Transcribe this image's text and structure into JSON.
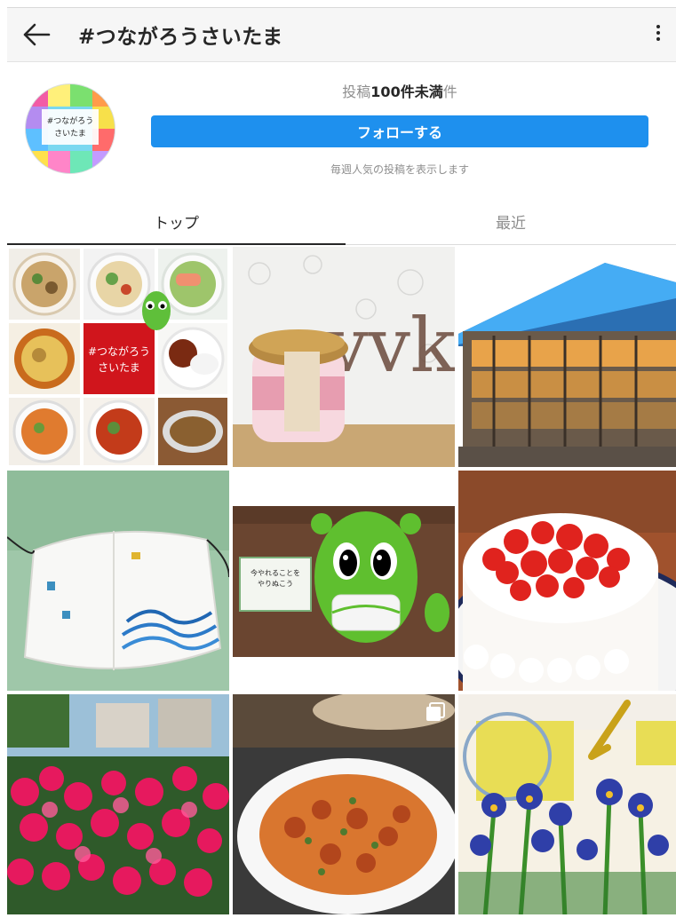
{
  "header": {
    "title": "#つながろうさいたま"
  },
  "profile": {
    "avatar_text": "#つながろう\nさいたま",
    "post_prefix": "投稿",
    "post_count": "100件未満",
    "post_suffix": "件",
    "follow_label": "フォローする",
    "weekly_note": "毎週人気の投稿を表示します"
  },
  "tabs": {
    "top": "トップ",
    "recent": "最近"
  },
  "posts": [
    {
      "id": "food-collage",
      "caption": "#つながろう\nさいたま"
    },
    {
      "id": "pudding-jar",
      "caption": "vvke"
    },
    {
      "id": "arena-building"
    },
    {
      "id": "wave-mask"
    },
    {
      "id": "mascot-with-mask",
      "sign_text": "今やれることを\nやりぬこう"
    },
    {
      "id": "strawberry-cake"
    },
    {
      "id": "red-azaleas"
    },
    {
      "id": "spaghetti-plate",
      "multi": true
    },
    {
      "id": "iris-embroidery"
    }
  ],
  "colors": {
    "follow_blue": "#1e90ee",
    "header_bg": "#f6f6f6",
    "muted_text": "#8e8e8e",
    "text": "#262626"
  }
}
